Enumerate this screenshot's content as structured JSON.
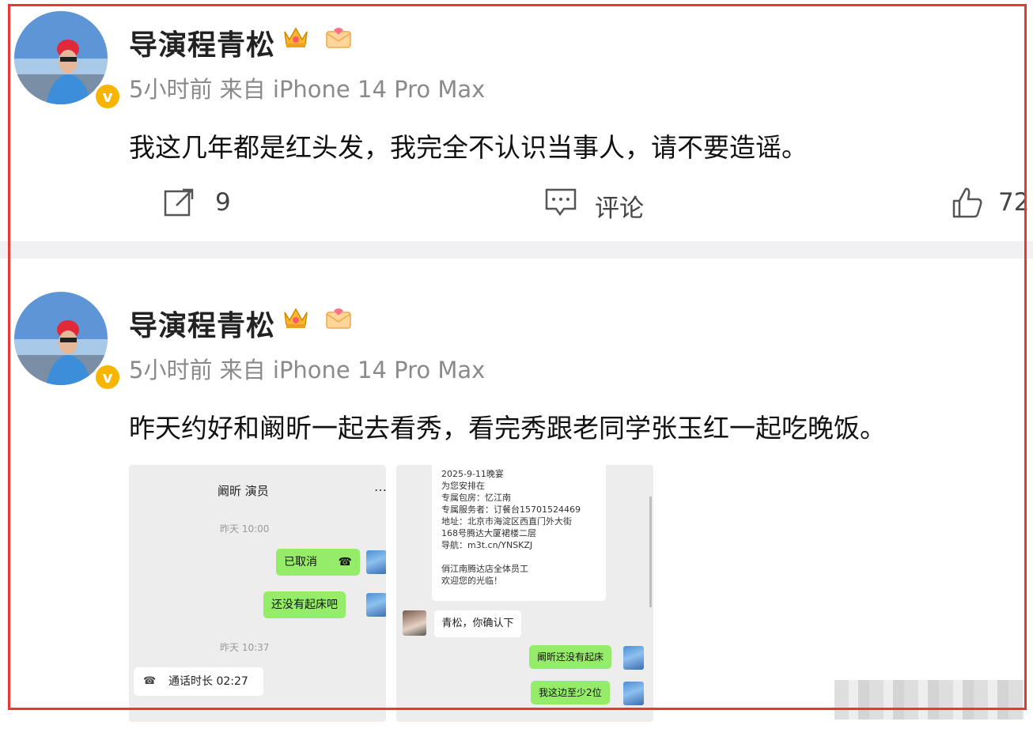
{
  "posts": [
    {
      "author": "导演程青松",
      "meta": "5小时前 来自 iPhone 14 Pro Max",
      "text": "我这几年都是红头发，我完全不认识当事人，请不要造谣。",
      "repost_count": "9",
      "comment_label": "评论",
      "like_count": "72"
    },
    {
      "author": "导演程青松",
      "meta": "5小时前 来自 iPhone 14 Pro Max",
      "text": "昨天约好和阚昕一起去看秀，看完秀跟老同学张玉红一起吃晚饭。"
    }
  ],
  "chat_left": {
    "title": "阚昕 演员",
    "menu": "…",
    "time1": "昨天 10:00",
    "msg1": "已取消",
    "msg2": "还没有起床吧",
    "time2": "昨天 10:37",
    "call": "通话时长 02:27"
  },
  "chat_right": {
    "card_lines": [
      "2025-9-11晚宴",
      "为您安排在",
      "专属包房：忆江南",
      "专属服务者：订餐台15701524469",
      "地址：北京市海淀区西直门外大街",
      "168号腾达大厦裙楼二层",
      "导航：m3t.cn/YNSKZJ",
      "",
      "俏江南腾达店全体员工",
      "欢迎您的光临！"
    ],
    "reply": "青松，你确认下",
    "msg1": "阚昕还没有起床",
    "msg2": "我这边至少2位"
  },
  "colors": {
    "frame": "#e53935",
    "verified": "#f7b500",
    "chat_green": "#95ec69"
  }
}
